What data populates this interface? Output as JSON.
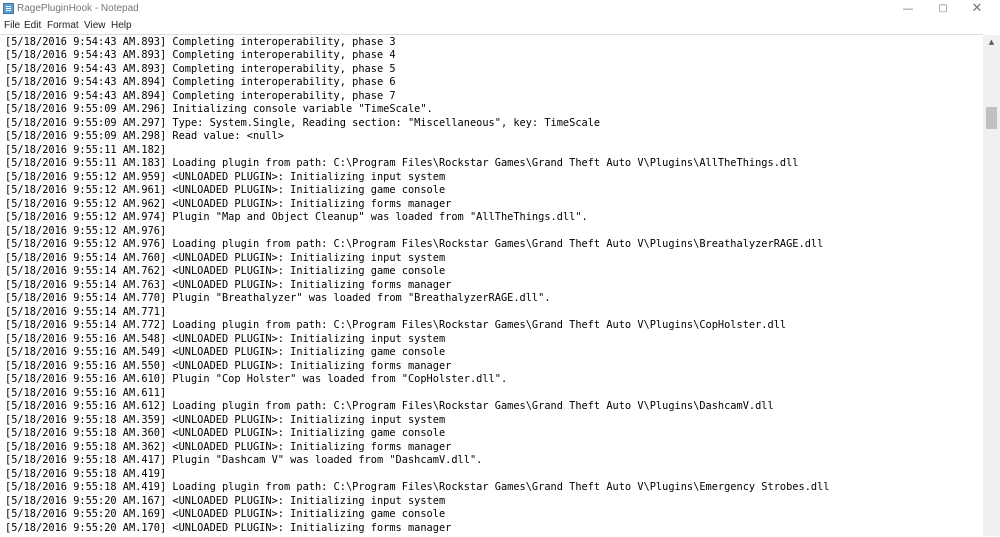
{
  "window": {
    "title": "RagePluginHook - Notepad",
    "controls": {
      "minimize": "—",
      "maximize": "▢",
      "close": "✕"
    }
  },
  "menu": [
    "File",
    "Edit",
    "Format",
    "View",
    "Help"
  ],
  "lines": [
    "[5/18/2016 9:54:43 AM.893] Completing interoperability, phase 3",
    "[5/18/2016 9:54:43 AM.893] Completing interoperability, phase 4",
    "[5/18/2016 9:54:43 AM.893] Completing interoperability, phase 5",
    "[5/18/2016 9:54:43 AM.894] Completing interoperability, phase 6",
    "[5/18/2016 9:54:43 AM.894] Completing interoperability, phase 7",
    "[5/18/2016 9:55:09 AM.296] Initializing console variable \"TimeScale\".",
    "[5/18/2016 9:55:09 AM.297] Type: System.Single, Reading section: \"Miscellaneous\", key: TimeScale",
    "[5/18/2016 9:55:09 AM.298] Read value: <null>",
    "[5/18/2016 9:55:11 AM.182]",
    "[5/18/2016 9:55:11 AM.183] Loading plugin from path: C:\\Program Files\\Rockstar Games\\Grand Theft Auto V\\Plugins\\AllTheThings.dll",
    "[5/18/2016 9:55:12 AM.959] <UNLOADED PLUGIN>: Initializing input system",
    "[5/18/2016 9:55:12 AM.961] <UNLOADED PLUGIN>: Initializing game console",
    "[5/18/2016 9:55:12 AM.962] <UNLOADED PLUGIN>: Initializing forms manager",
    "[5/18/2016 9:55:12 AM.974] Plugin \"Map and Object Cleanup\" was loaded from \"AllTheThings.dll\".",
    "[5/18/2016 9:55:12 AM.976]",
    "[5/18/2016 9:55:12 AM.976] Loading plugin from path: C:\\Program Files\\Rockstar Games\\Grand Theft Auto V\\Plugins\\BreathalyzerRAGE.dll",
    "[5/18/2016 9:55:14 AM.760] <UNLOADED PLUGIN>: Initializing input system",
    "[5/18/2016 9:55:14 AM.762] <UNLOADED PLUGIN>: Initializing game console",
    "[5/18/2016 9:55:14 AM.763] <UNLOADED PLUGIN>: Initializing forms manager",
    "[5/18/2016 9:55:14 AM.770] Plugin \"Breathalyzer\" was loaded from \"BreathalyzerRAGE.dll\".",
    "[5/18/2016 9:55:14 AM.771]",
    "[5/18/2016 9:55:14 AM.772] Loading plugin from path: C:\\Program Files\\Rockstar Games\\Grand Theft Auto V\\Plugins\\CopHolster.dll",
    "[5/18/2016 9:55:16 AM.548] <UNLOADED PLUGIN>: Initializing input system",
    "[5/18/2016 9:55:16 AM.549] <UNLOADED PLUGIN>: Initializing game console",
    "[5/18/2016 9:55:16 AM.550] <UNLOADED PLUGIN>: Initializing forms manager",
    "[5/18/2016 9:55:16 AM.610] Plugin \"Cop Holster\" was loaded from \"CopHolster.dll\".",
    "[5/18/2016 9:55:16 AM.611]",
    "[5/18/2016 9:55:16 AM.612] Loading plugin from path: C:\\Program Files\\Rockstar Games\\Grand Theft Auto V\\Plugins\\DashcamV.dll",
    "[5/18/2016 9:55:18 AM.359] <UNLOADED PLUGIN>: Initializing input system",
    "[5/18/2016 9:55:18 AM.360] <UNLOADED PLUGIN>: Initializing game console",
    "[5/18/2016 9:55:18 AM.362] <UNLOADED PLUGIN>: Initializing forms manager",
    "[5/18/2016 9:55:18 AM.417] Plugin \"Dashcam V\" was loaded from \"DashcamV.dll\".",
    "[5/18/2016 9:55:18 AM.419]",
    "[5/18/2016 9:55:18 AM.419] Loading plugin from path: C:\\Program Files\\Rockstar Games\\Grand Theft Auto V\\Plugins\\Emergency Strobes.dll",
    "[5/18/2016 9:55:20 AM.167] <UNLOADED PLUGIN>: Initializing input system",
    "[5/18/2016 9:55:20 AM.169] <UNLOADED PLUGIN>: Initializing game console",
    "[5/18/2016 9:55:20 AM.170] <UNLOADED PLUGIN>: Initializing forms manager"
  ]
}
